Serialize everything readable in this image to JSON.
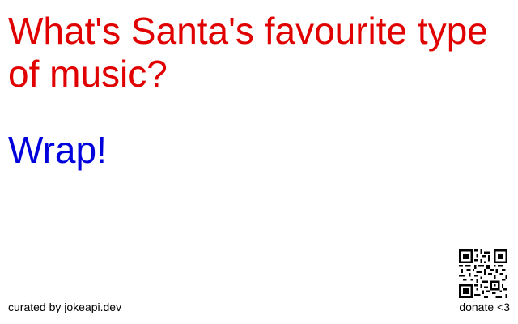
{
  "joke": {
    "setup": "What's Santa's favourite type of music?",
    "delivery": "Wrap!"
  },
  "footer": {
    "credit": "curated by jokeapi.dev",
    "donate": "donate <3"
  },
  "colors": {
    "setup": "#e00000",
    "delivery": "#0000dd",
    "text": "#000000",
    "background": "#ffffff"
  },
  "icons": {
    "qr": "qr-code-icon"
  }
}
